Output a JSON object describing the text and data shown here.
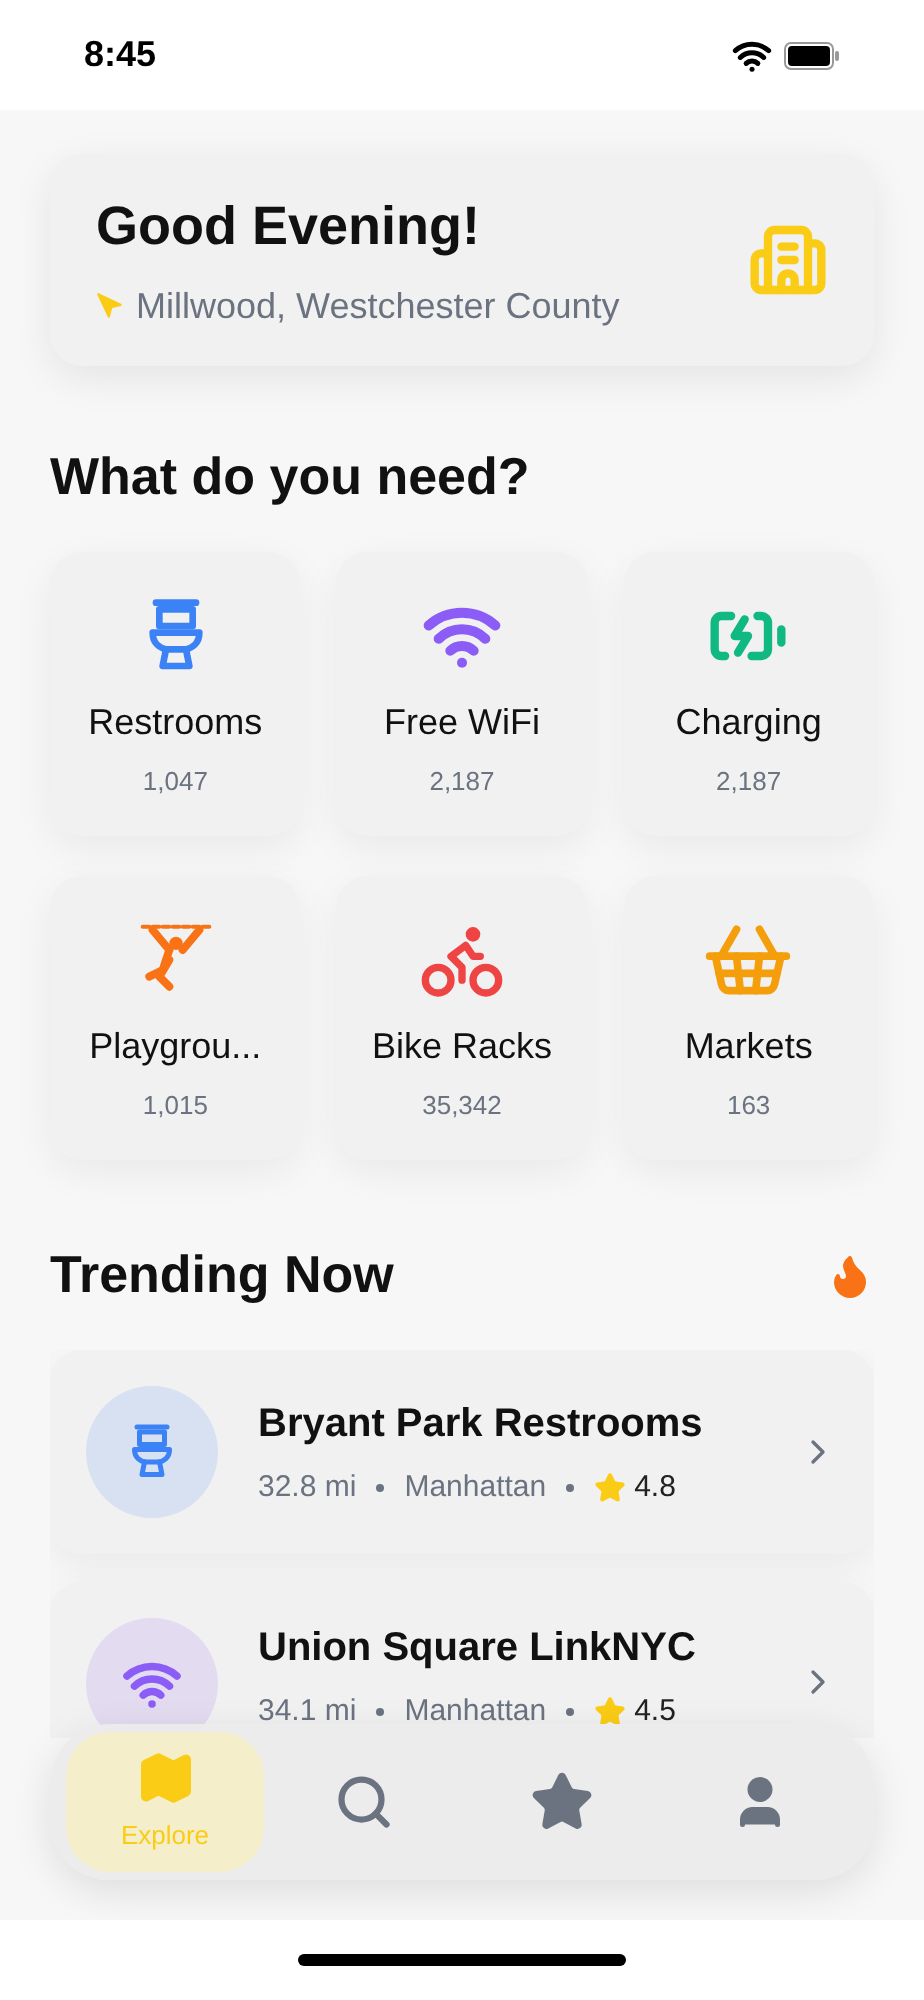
{
  "status_bar": {
    "time": "8:45"
  },
  "header": {
    "greeting": "Good Evening!",
    "location": "Millwood, Westchester County"
  },
  "categories_section": {
    "title": "What do you need?"
  },
  "categories": [
    {
      "name": "Restrooms",
      "count": "1,047",
      "color": "#3b82f6"
    },
    {
      "name": "Free WiFi",
      "count": "2,187",
      "color": "#8b5cf6"
    },
    {
      "name": "Charging",
      "count": "2,187",
      "color": "#10b981"
    },
    {
      "name": "Playgrou...",
      "count": "1,015",
      "color": "#f97316"
    },
    {
      "name": "Bike Racks",
      "count": "35,342",
      "color": "#ef4444"
    },
    {
      "name": "Markets",
      "count": "163",
      "color": "#f59e0b"
    }
  ],
  "trending_section": {
    "title": "Trending Now"
  },
  "trending": [
    {
      "name": "Bryant Park Restrooms",
      "distance": "32.8 mi",
      "area": "Manhattan",
      "rating": "4.8",
      "color": "#3b82f6",
      "kind": "restroom"
    },
    {
      "name": "Union Square LinkNYC",
      "distance": "34.1 mi",
      "area": "Manhattan",
      "rating": "4.5",
      "color": "#8b5cf6",
      "kind": "wifi"
    }
  ],
  "tab_bar": [
    {
      "label": "Explore",
      "selected": true
    },
    {
      "selected": false
    },
    {
      "selected": false
    },
    {
      "selected": false
    }
  ]
}
